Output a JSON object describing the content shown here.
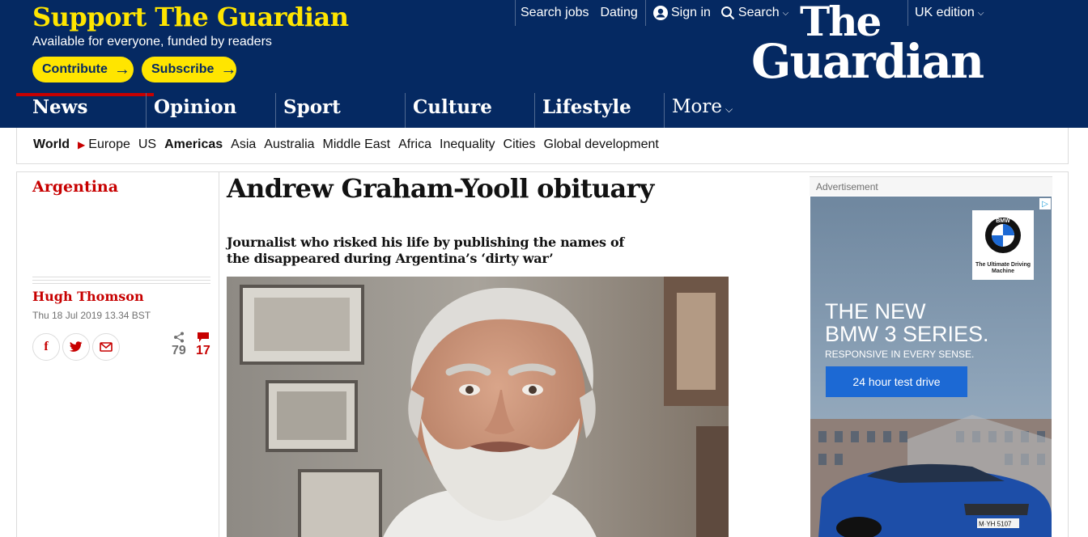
{
  "support": {
    "title": "Support The Guardian",
    "subtitle": "Available for everyone, funded by readers",
    "contribute_label": "Contribute",
    "subscribe_label": "Subscribe",
    "arrow": "→"
  },
  "topbar": {
    "search_jobs": "Search jobs",
    "dating": "Dating",
    "sign_in": "Sign in",
    "search": "Search",
    "edition": "UK edition"
  },
  "logo": {
    "line1": "The",
    "line2": "Guardian"
  },
  "pillars": [
    {
      "label": "News",
      "active": true
    },
    {
      "label": "Opinion"
    },
    {
      "label": "Sport"
    },
    {
      "label": "Culture"
    },
    {
      "label": "Lifestyle"
    },
    {
      "label": "More"
    }
  ],
  "subnav": {
    "parent": "World",
    "items": [
      "Europe",
      "US",
      "Americas",
      "Asia",
      "Australia",
      "Middle East",
      "Africa",
      "Inequality",
      "Cities",
      "Global development"
    ],
    "current": "Americas"
  },
  "article": {
    "section": "Argentina",
    "headline": "Andrew Graham-Yooll obituary",
    "standfirst": "Journalist who risked his life by publishing the names of the disappeared during Argentina’s ‘dirty war’",
    "author": "Hugh Thomson",
    "date": "Thu 18 Jul 2019 13.34 BST",
    "share_count": "79",
    "comment_count": "17"
  },
  "advert": {
    "label": "Advertisement",
    "tagline": "The Ultimate Driving Machine",
    "headline_1": "THE NEW",
    "headline_2": "BMW 3 SERIES.",
    "sub": "RESPONSIVE IN EVERY SENSE.",
    "cta": "24 hour test drive",
    "brand_letters": "BMW",
    "plate": "M·YH 5107"
  },
  "colors": {
    "brand_blue": "#052962",
    "support_yellow": "#ffe500",
    "news_red": "#c70000",
    "bmw_blue": "#1c69d4"
  }
}
